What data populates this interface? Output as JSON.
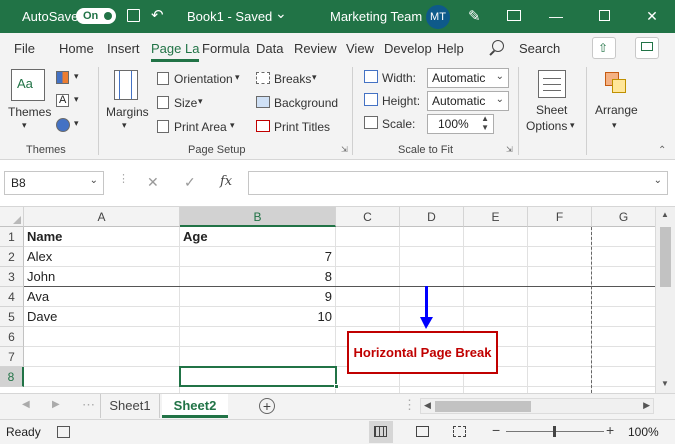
{
  "titlebar": {
    "autosave_label": "AutoSave",
    "autosave_state": "On",
    "doc_title": "Book1  -  Saved",
    "dropdown_glyph": "⌄",
    "team_name": "Marketing Team",
    "avatar_initials": "MT",
    "accent_color": "#217346"
  },
  "menu": {
    "tabs": [
      "File",
      "Home",
      "Insert",
      "Page La",
      "Formula",
      "Data",
      "Review",
      "View",
      "Develop",
      "Help"
    ],
    "active_tab": "Page La",
    "search_label": "Search"
  },
  "ribbon": {
    "themes": {
      "button_label": "Themes",
      "group_label": "Themes"
    },
    "page_setup": {
      "margins_label": "Margins",
      "orientation_label": "Orientation",
      "size_label": "Size",
      "print_area_label": "Print Area",
      "breaks_label": "Breaks",
      "background_label": "Background",
      "print_titles_label": "Print Titles",
      "group_label": "Page Setup"
    },
    "scale_to_fit": {
      "width_label": "Width:",
      "width_value": "Automatic",
      "height_label": "Height:",
      "height_value": "Automatic",
      "scale_label": "Scale:",
      "scale_value": "100%",
      "group_label": "Scale to Fit"
    },
    "sheet_options": {
      "label_line1": "Sheet",
      "label_line2": "Options"
    },
    "arrange": {
      "label": "Arrange"
    }
  },
  "formula_bar": {
    "name_box": "B8",
    "fx_label": "fx",
    "cancel_glyph": "✕",
    "enter_glyph": "✓",
    "content": ""
  },
  "grid": {
    "columns": [
      "A",
      "B",
      "C",
      "D",
      "E",
      "F",
      "G"
    ],
    "rows": [
      "1",
      "2",
      "3",
      "4",
      "5",
      "6",
      "7",
      "8"
    ],
    "cells": {
      "A1": "Name",
      "B1": "Age",
      "A2": "Alex",
      "B2": "7",
      "A3": "John",
      "B3": "8",
      "A4": "Ava",
      "B4": "9",
      "A5": "Dave",
      "B5": "10"
    },
    "selected_cell": "B8",
    "annotation": "Horizontal Page Break",
    "annotation_color": "#c00000",
    "arrow_color": "#0000ff"
  },
  "sheets": {
    "tabs": [
      "Sheet1",
      "Sheet2"
    ],
    "active": "Sheet2"
  },
  "status": {
    "ready": "Ready",
    "zoom": "100%",
    "minus": "−",
    "plus": "+"
  }
}
